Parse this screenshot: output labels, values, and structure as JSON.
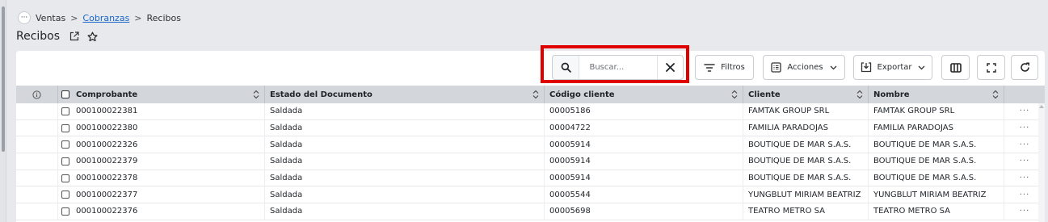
{
  "breadcrumb": {
    "dots": "···",
    "items": [
      "Ventas",
      "Cobranzas",
      "Recibos"
    ],
    "separator": ">"
  },
  "page": {
    "title": "Recibos"
  },
  "toolbar": {
    "search_placeholder": "Buscar...",
    "filters_label": "Filtros",
    "actions_label": "Acciones",
    "export_label": "Exportar"
  },
  "table": {
    "columns": [
      "Comprobante",
      "Estado del Documento",
      "Código cliente",
      "Cliente",
      "Nombre"
    ],
    "more_glyph": "···",
    "rows": [
      [
        "000100022381",
        "Saldada",
        "00005186",
        "FAMTAK GROUP SRL",
        "FAMTAK GROUP SRL"
      ],
      [
        "000100022380",
        "Saldada",
        "00004722",
        "FAMILIA PARADOJAS",
        "FAMILIA PARADOJAS"
      ],
      [
        "000100022326",
        "Saldada",
        "00005914",
        "BOUTIQUE DE MAR S.A.S.",
        "BOUTIQUE DE MAR S.A.S."
      ],
      [
        "000100022379",
        "Saldada",
        "00005914",
        "BOUTIQUE DE MAR S.A.S.",
        "BOUTIQUE DE MAR S.A.S."
      ],
      [
        "000100022378",
        "Saldada",
        "00005914",
        "BOUTIQUE DE MAR S.A.S.",
        "BOUTIQUE DE MAR S.A.S."
      ],
      [
        "000100022377",
        "Saldada",
        "00005544",
        "YUNGBLUT MIRIAM BEATRIZ",
        "YUNGBLUT MIRIAM BEATRIZ"
      ],
      [
        "000100022376",
        "Saldada",
        "00005698",
        "TEATRO METRO SA",
        "TEATRO METRO SA"
      ]
    ]
  },
  "colors": {
    "highlight": "#e00000",
    "link": "#1a66c9",
    "header_bg": "#d3d6db"
  }
}
